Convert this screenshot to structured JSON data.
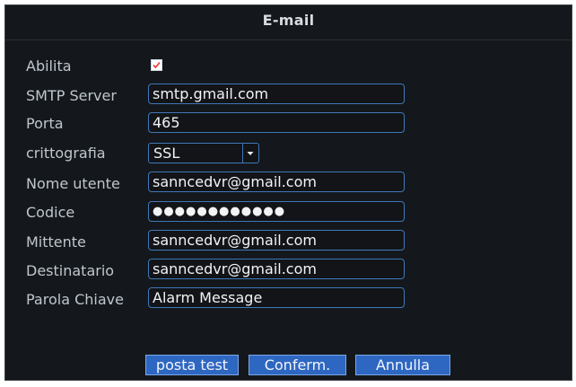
{
  "dialog": {
    "title": "E-mail"
  },
  "form": {
    "enable": {
      "label": "Abilita",
      "checked": true
    },
    "smtp_server": {
      "label": "SMTP Server",
      "value": "smtp.gmail.com"
    },
    "port": {
      "label": "Porta",
      "value": "465"
    },
    "encryption": {
      "label": "crittografia",
      "value": "SSL"
    },
    "username": {
      "label": "Nome utente",
      "value": "sanncedvr@gmail.com"
    },
    "password": {
      "label": "Codice",
      "value": "●●●●●●●●●●●●"
    },
    "sender": {
      "label": "Mittente",
      "value": "sanncedvr@gmail.com"
    },
    "recipient": {
      "label": "Destinatario",
      "value": "sanncedvr@gmail.com"
    },
    "keyword": {
      "label": "Parola Chiave",
      "value": "Alarm Message"
    }
  },
  "buttons": {
    "test_label": "posta test",
    "confirm_label": "Conferm.",
    "cancel_label": "Annulla"
  },
  "colors": {
    "background": "#14181c",
    "field_border": "#3f78b8",
    "button": "#2e67c1",
    "checkmark": "#e53935"
  },
  "icons": {
    "checkbox": "checkmark-icon",
    "dropdown": "triangle-down-icon"
  }
}
